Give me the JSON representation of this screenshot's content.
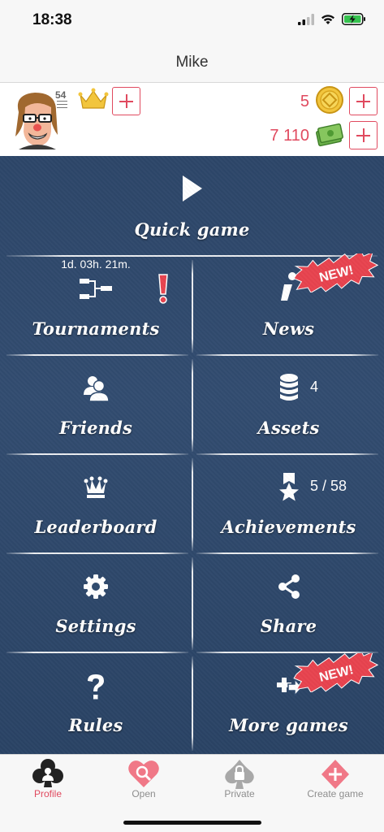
{
  "status": {
    "time": "18:38"
  },
  "nav": {
    "title": "Mike"
  },
  "profile": {
    "level": "54",
    "coins": "5",
    "cash": "7 110"
  },
  "menu": {
    "quick_game": "Quick game",
    "tournaments": "Tournaments",
    "tournament_timer": "1d. 03h. 21m.",
    "news": "News",
    "new_badge": "NEW!",
    "friends": "Friends",
    "assets": "Assets",
    "assets_count": "4",
    "leaderboard": "Leaderboard",
    "achievements": "Achievements",
    "achievements_count": "5 / 58",
    "settings": "Settings",
    "share": "Share",
    "rules": "Rules",
    "more_games": "More games"
  },
  "tabs": [
    {
      "label": "Profile",
      "icon": "club-profile-icon"
    },
    {
      "label": "Open",
      "icon": "heart-search-icon"
    },
    {
      "label": "Private",
      "icon": "spade-lock-icon"
    },
    {
      "label": "Create game",
      "icon": "diamond-plus-icon"
    }
  ],
  "colors": {
    "accent": "#e04a5f",
    "menu_bg": "#2f4a6e",
    "badge": "#e8434f"
  }
}
